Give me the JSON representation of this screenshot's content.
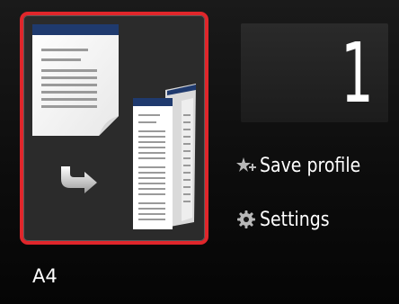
{
  "copy_settings": {
    "layout_option": "2-sided",
    "copies": "1",
    "paper_size": "A4"
  },
  "menu": {
    "save_profile_label": "Save profile",
    "settings_label": "Settings"
  },
  "icons": {
    "save_profile": "star-plus-icon",
    "settings": "gear-icon",
    "layout_arrow": "arrow-right-icon"
  },
  "colors": {
    "selection_border": "#e0262b",
    "document_header": "#1f3a6e"
  }
}
